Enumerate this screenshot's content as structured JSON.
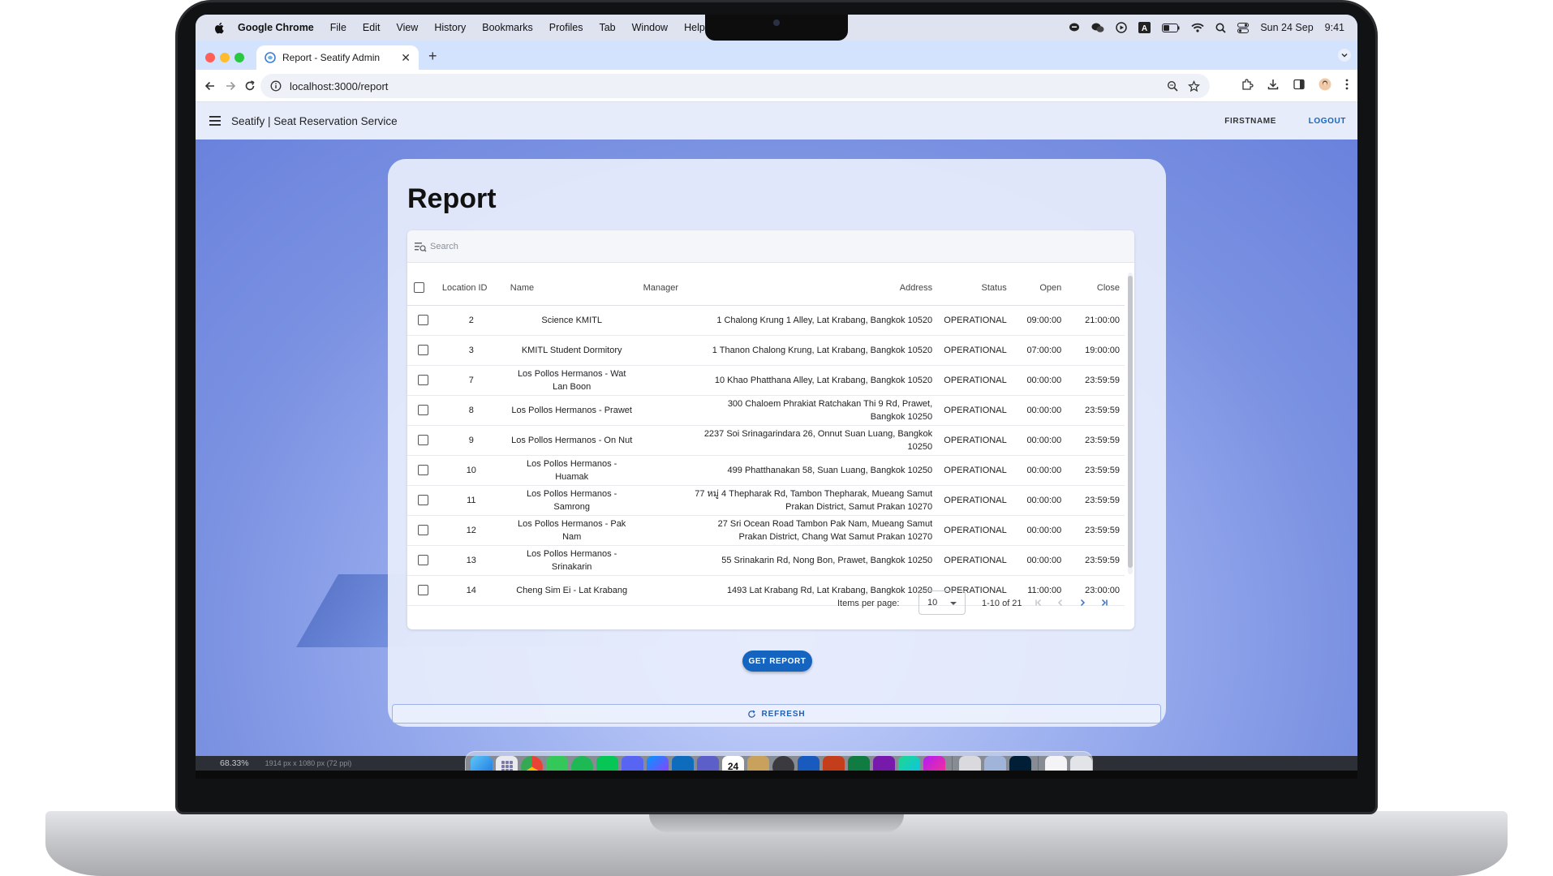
{
  "menubar": {
    "app_name": "Google Chrome",
    "items": [
      "File",
      "Edit",
      "View",
      "History",
      "Bookmarks",
      "Profiles",
      "Tab",
      "Window",
      "Help"
    ],
    "date": "Sun 24 Sep",
    "time": "9:41"
  },
  "browser": {
    "tab_title": "Report - Seatify Admin",
    "url": "localhost:3000/report"
  },
  "app": {
    "title": "Seatify | Seat Reservation Service",
    "user": "FIRSTNAME",
    "logout": "LOGOUT"
  },
  "page": {
    "heading": "Report",
    "search_placeholder": "Search",
    "columns": {
      "location_id": "Location ID",
      "name": "Name",
      "manager": "Manager",
      "address": "Address",
      "status": "Status",
      "open": "Open",
      "close": "Close"
    },
    "rows": [
      {
        "id": "2",
        "name": "Science KMITL",
        "manager": "",
        "address": "1 Chalong Krung 1 Alley, Lat Krabang, Bangkok 10520",
        "status": "OPERATIONAL",
        "open": "09:00:00",
        "close": "21:00:00"
      },
      {
        "id": "3",
        "name": "KMITL Student Dormitory",
        "manager": "",
        "address": "1 Thanon Chalong Krung, Lat Krabang, Bangkok 10520",
        "status": "OPERATIONAL",
        "open": "07:00:00",
        "close": "19:00:00"
      },
      {
        "id": "7",
        "name": "Los Pollos Hermanos - Wat Lan Boon",
        "manager": "",
        "address": "10 Khao Phatthana Alley, Lat Krabang, Bangkok 10520",
        "status": "OPERATIONAL",
        "open": "00:00:00",
        "close": "23:59:59"
      },
      {
        "id": "8",
        "name": "Los Pollos Hermanos - Prawet",
        "manager": "",
        "address": "300 Chaloem Phrakiat Ratchakan Thi 9 Rd, Prawet, Bangkok 10250",
        "status": "OPERATIONAL",
        "open": "00:00:00",
        "close": "23:59:59"
      },
      {
        "id": "9",
        "name": "Los Pollos Hermanos - On Nut",
        "manager": "",
        "address": "2237 Soi Srinagarindara 26, Onnut Suan Luang, Bangkok 10250",
        "status": "OPERATIONAL",
        "open": "00:00:00",
        "close": "23:59:59"
      },
      {
        "id": "10",
        "name": "Los Pollos Hermanos - Huamak",
        "manager": "",
        "address": "499 Phatthanakan 58, Suan Luang, Bangkok 10250",
        "status": "OPERATIONAL",
        "open": "00:00:00",
        "close": "23:59:59"
      },
      {
        "id": "11",
        "name": "Los Pollos Hermanos - Samrong",
        "manager": "",
        "address": "77 หมู่ 4 Thepharak Rd, Tambon Thepharak, Mueang Samut Prakan District, Samut Prakan 10270",
        "status": "OPERATIONAL",
        "open": "00:00:00",
        "close": "23:59:59"
      },
      {
        "id": "12",
        "name": "Los Pollos Hermanos - Pak Nam",
        "manager": "",
        "address": "27 Sri Ocean Road Tambon Pak Nam, Mueang Samut Prakan District, Chang Wat Samut Prakan 10270",
        "status": "OPERATIONAL",
        "open": "00:00:00",
        "close": "23:59:59"
      },
      {
        "id": "13",
        "name": "Los Pollos Hermanos - Srinakarin",
        "manager": "",
        "address": "55 Srinakarin Rd, Nong Bon, Prawet, Bangkok 10250",
        "status": "OPERATIONAL",
        "open": "00:00:00",
        "close": "23:59:59"
      },
      {
        "id": "14",
        "name": "Cheng Sim Ei - Lat Krabang",
        "manager": "",
        "address": "1493 Lat Krabang Rd, Lat Krabang, Bangkok 10250",
        "status": "OPERATIONAL",
        "open": "11:00:00",
        "close": "23:00:00"
      }
    ],
    "paginator": {
      "label": "Items per page:",
      "page_size": "10",
      "range": "1-10 of 21"
    },
    "get_report": "GET REPORT",
    "refresh": "REFRESH"
  },
  "statusline": {
    "zoom": "68.33%",
    "dimensions": "1914 px x 1080 px (72 ppi)"
  },
  "dock": {
    "calendar_day": "24"
  },
  "colors": {
    "accent": "#1565c0",
    "chrome_tab_strip": "#d3e3fd",
    "app_header": "#e6ecfa"
  }
}
